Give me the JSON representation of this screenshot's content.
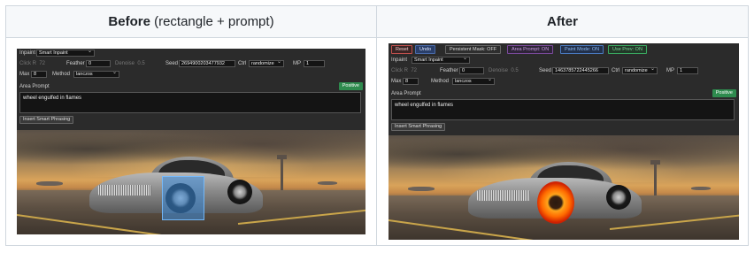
{
  "header": {
    "before_bold": "Before",
    "before_rest": " (rectangle + prompt)",
    "after": "After"
  },
  "left_ui": {
    "inpaint_label": "Inpaint",
    "inpaint_value": "Smart Inpaint",
    "click_r_label": "Click R",
    "click_r_value": "72",
    "feather_label": "Feather",
    "feather_value": "0",
    "denoise_label": "Denoise",
    "denoise_value": "0.5",
    "seed_label": "Seed",
    "seed_value": "2694900203477932",
    "ctrl_label": "Ctrl",
    "ctrl_value": "randomize",
    "mp_label": "MP",
    "mp_value": "1",
    "max_label": "Max",
    "max_value": "8",
    "method_label": "Method",
    "method_value": "lanczos",
    "area_prompt_label": "Area Prompt",
    "positive_label": "Positive",
    "prompt_text": "wheel engulfed in flames",
    "insert_button": "Insert Smart Phrasing"
  },
  "right_ui": {
    "toolbar": {
      "reset": "Reset",
      "undo": "Undo",
      "persistent_mask": "Persistent Mask: OFF",
      "area_prompt": "Area Prompt: ON",
      "paint_mode": "Paint Mode: ON",
      "use_prev": "Use Prev: ON"
    },
    "inpaint_label": "Inpaint",
    "inpaint_value": "Smart Inpaint",
    "click_r_label": "Click R",
    "click_r_value": "72",
    "feather_label": "Feather",
    "feather_value": "0",
    "denoise_label": "Denoise",
    "denoise_value": "0.5",
    "seed_label": "Seed",
    "seed_value": "1463785722445266",
    "ctrl_label": "Ctrl",
    "ctrl_value": "randomize",
    "mp_label": "MP",
    "mp_value": "1",
    "max_label": "Max",
    "max_value": "8",
    "method_label": "Method",
    "method_value": "lanczos",
    "area_prompt_label": "Area Prompt",
    "positive_label": "Positive",
    "prompt_text": "wheel engulfed in flames",
    "insert_button": "Insert Smart Phrasing"
  },
  "colors": {
    "positive": "#2e8b4e",
    "mask_overlay": "#3c8cdc",
    "reset_border": "#c0504d",
    "undo_bg": "#2a3f6a",
    "area_prompt_color": "#b070d0",
    "paint_mode_color": "#4a8fd8",
    "use_prev_color": "#3aa860"
  }
}
